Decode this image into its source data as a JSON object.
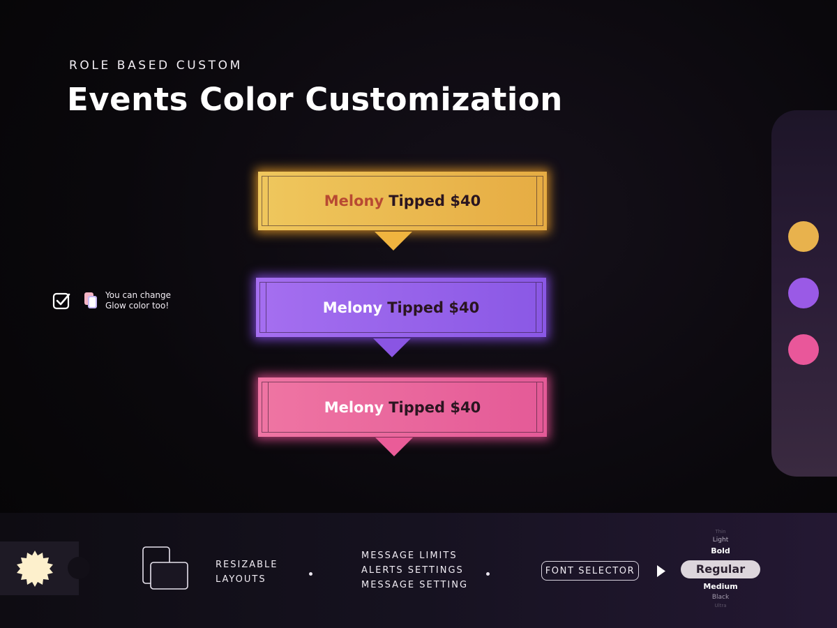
{
  "header": {
    "subtitle": "ROLE BASED CUSTOM",
    "title": "Events Color Customization"
  },
  "alerts": [
    {
      "name": "Melony",
      "message": "Tipped $40",
      "color": "#ebbb51",
      "name_color": "#b84a32"
    },
    {
      "name": "Melony",
      "message": "Tipped $40",
      "color": "#9b63ec",
      "name_color": "#ffffff"
    },
    {
      "name": "Melony",
      "message": "Tipped $40",
      "color": "#ea6a9f",
      "name_color": "#ffffff"
    }
  ],
  "palette": {
    "swatches": [
      "#e8b24d",
      "#9a5ae6",
      "#e9579a"
    ]
  },
  "note": {
    "line1": "You can change",
    "line2": "Glow color too!"
  },
  "bottom": {
    "resizable_line1": "RESIZABLE",
    "resizable_line2": "LAYOUTS",
    "settings_line1": "MESSAGE LIMITS",
    "settings_line2": "ALERTS SETTINGS",
    "settings_line3": "MESSAGE SETTING",
    "font_selector": "FONT SELECTOR",
    "weights": {
      "thin": "Thin",
      "light": "Light",
      "bold": "Bold",
      "regular": "Regular",
      "medium": "Medium",
      "black": "Black",
      "ultra": "Ultra"
    }
  },
  "icons": {
    "badge": "badge-icon",
    "layout": "layout-icon",
    "check": "checkbox-icon",
    "glow": "glow-icon",
    "play": "play-icon"
  }
}
